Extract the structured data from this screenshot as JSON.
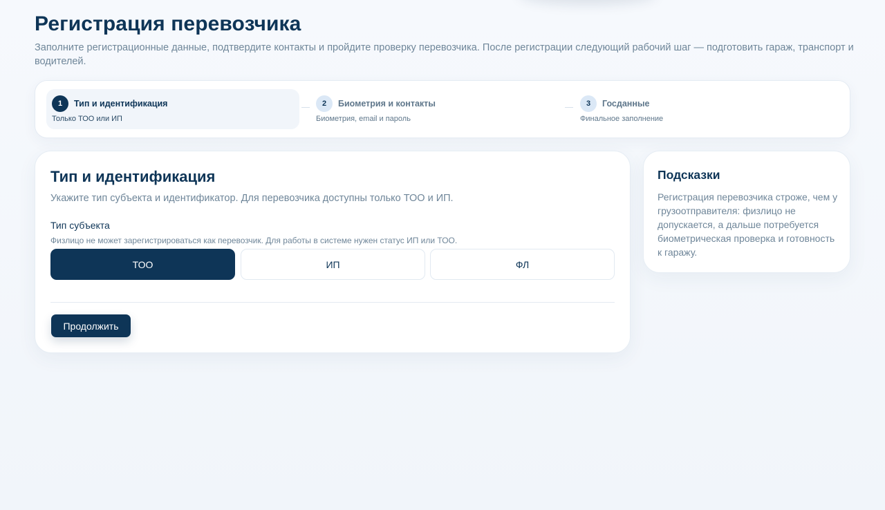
{
  "header": {
    "title": "Регистрация перевозчика",
    "subtitle": "Заполните регистрационные данные, подтвердите контакты и пройдите проверку перевозчика. После регистрации следующий рабочий шаг — подготовить гараж, транспорт и водителей."
  },
  "stepper": {
    "steps": [
      {
        "num": "1",
        "label": "Тип и идентификация",
        "sub": "Только ТОО или ИП",
        "active": true
      },
      {
        "num": "2",
        "label": "Биометрия и контакты",
        "sub": "Биометрия, email и пароль",
        "active": false
      },
      {
        "num": "3",
        "label": "Госданные",
        "sub": "Финальное заполнение",
        "active": false
      }
    ]
  },
  "form": {
    "title": "Тип и идентификация",
    "description": "Укажите тип субъекта и идентификатор. Для перевозчика доступны только ТОО и ИП.",
    "entity_label": "Тип субъекта",
    "entity_hint": "Физлицо не может зарегистрироваться как перевозчик. Для работы в системе нужен статус ИП или ТОО.",
    "options": [
      "ТОО",
      "ИП",
      "ФЛ"
    ],
    "selected_option": "ТОО",
    "continue_label": "Продолжить"
  },
  "hints": {
    "title": "Подсказки",
    "text": "Регистрация перевозчика строже, чем у грузоотправителя: физлицо не допускается, а дальше потребуется биометрическая проверка и готовность к гаражу."
  },
  "colors": {
    "primary": "#0e3557",
    "muted": "#6f8699",
    "step_badge": "#dbe8f6",
    "background": "#f4f7fb"
  }
}
